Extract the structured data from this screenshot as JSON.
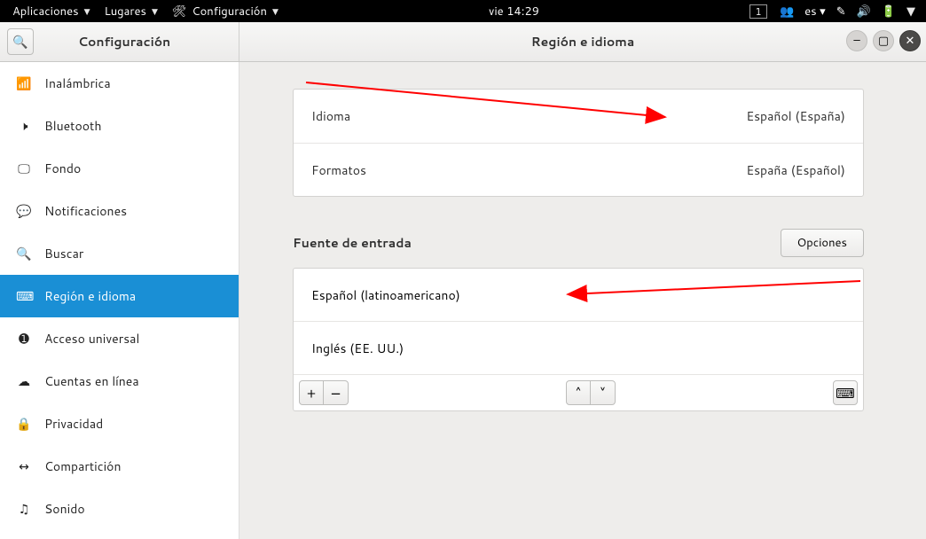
{
  "topbar": {
    "apps": "Aplicaciones",
    "places": "Lugares",
    "config": "Configuración",
    "clock": "vie 14:29",
    "workspace": "1",
    "lang_ind": "es"
  },
  "header": {
    "left_title": "Configuración",
    "center_title": "Región e idioma"
  },
  "sidebar": {
    "items": [
      {
        "icon": "📶",
        "label": "Inalámbrica"
      },
      {
        "icon": "🕨",
        "label": "Bluetooth"
      },
      {
        "icon": "🖵",
        "label": "Fondo"
      },
      {
        "icon": "💬",
        "label": "Notificaciones"
      },
      {
        "icon": "🔍",
        "label": "Buscar"
      },
      {
        "icon": "⌨",
        "label": "Región e idioma"
      },
      {
        "icon": "➊",
        "label": "Acceso universal"
      },
      {
        "icon": "☁",
        "label": "Cuentas en línea"
      },
      {
        "icon": "🔒",
        "label": "Privacidad"
      },
      {
        "icon": "↔",
        "label": "Compartición"
      },
      {
        "icon": "♫",
        "label": "Sonido"
      }
    ]
  },
  "language_panel": {
    "rows": [
      {
        "label": "Idioma",
        "value": "Español (España)"
      },
      {
        "label": "Formatos",
        "value": "España (Español)"
      }
    ]
  },
  "input_section": {
    "title": "Fuente de entrada",
    "options_btn": "Opciones",
    "sources": [
      "Español (latinoamericano)",
      "Inglés (EE. UU.)"
    ],
    "toolbar": {
      "add": "+",
      "remove": "−",
      "up": "˄",
      "down": "˅",
      "keyboard": "⌨"
    }
  }
}
